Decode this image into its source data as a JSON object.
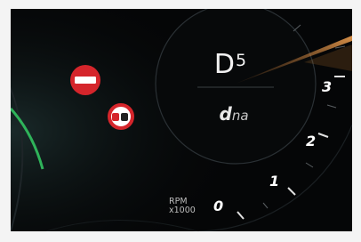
{
  "gear": {
    "mode": "D",
    "number": "5"
  },
  "drive_mode": {
    "brand_d": "d",
    "brand_na": "na"
  },
  "tachometer": {
    "unit_line1": "RPM",
    "unit_line2": "x1000",
    "ticks": [
      "0",
      "1",
      "2",
      "3"
    ],
    "accent_color": "#d98a3a"
  },
  "warnings": [
    {
      "name": "no-entry-sign",
      "color": "#d5252b"
    },
    {
      "name": "no-overtaking-sign",
      "color": "#d5252b"
    }
  ]
}
